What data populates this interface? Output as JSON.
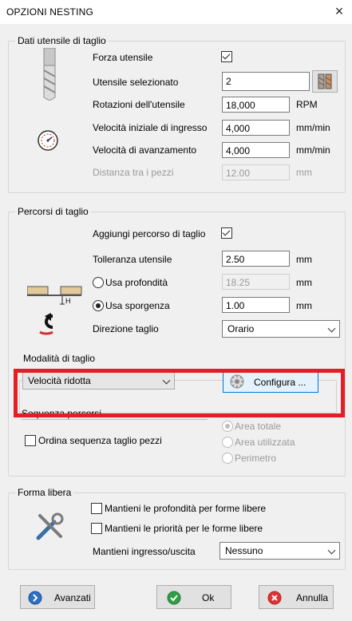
{
  "window": {
    "title": "OPZIONI NESTING",
    "close_glyph": "×"
  },
  "tool_data": {
    "title": "Dati utensile di taglio",
    "force_tool_label": "Forza utensile",
    "force_tool_checked": true,
    "selected_tool_label": "Utensile selezionato",
    "selected_tool_value": "2",
    "rotation_label": "Rotazioni dell'utensile",
    "rotation_value": "18,000",
    "rotation_unit": "RPM",
    "entry_speed_label": "Velocità iniziale di ingresso",
    "entry_speed_value": "4,000",
    "entry_speed_unit": "mm/min",
    "feed_speed_label": "Velocità di avanzamento",
    "feed_speed_value": "4,000",
    "feed_speed_unit": "mm/min",
    "piece_distance_label": "Distanza tra i pezzi",
    "piece_distance_value": "12.00",
    "piece_distance_unit": "mm"
  },
  "cut_paths": {
    "title": "Percorsi di taglio",
    "add_path_label": "Aggiungi percorso di taglio",
    "add_path_checked": true,
    "tolerance_label": "Tolleranza utensile",
    "tolerance_value": "2.50",
    "tolerance_unit": "mm",
    "use_depth_label": "Usa profondità",
    "use_depth_value": "18.25",
    "use_depth_unit": "mm",
    "use_overhang_label": "Usa sporgenza",
    "use_overhang_value": "1.00",
    "use_overhang_unit": "mm",
    "direction_label": "Direzione taglio",
    "direction_value": "Orario",
    "diagram_h_label": "H"
  },
  "cut_mode": {
    "title": "Modalità di taglio",
    "mode_value": "Velocità ridotta",
    "configure_label": "Configura ..."
  },
  "sequence": {
    "title": "Sequenza percorsi",
    "order_label": "Ordina sequenza taglio pezzi",
    "order_checked": false,
    "options": [
      "Area totale",
      "Area utilizzata",
      "Perimetro"
    ],
    "selected_option": "Area totale"
  },
  "free_form": {
    "title": "Forma libera",
    "keep_depth_label": "Mantieni le profondità per forme libere",
    "keep_priority_label": "Mantieni le priorità per le forme libere",
    "keep_entry_label": "Mantieni ingresso/uscita",
    "keep_entry_value": "Nessuno"
  },
  "footer": {
    "advanced_label": "Avanzati",
    "ok_label": "Ok",
    "cancel_label": "Annulla"
  },
  "colors": {
    "highlight_border": "#e31e24",
    "dialog_bg": "#f0f0f0"
  }
}
